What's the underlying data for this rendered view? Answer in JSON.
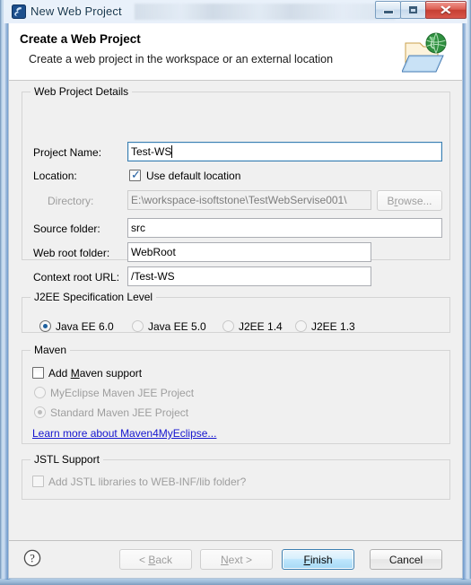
{
  "window": {
    "title": "New Web Project",
    "icon": "myeclipse-icon",
    "controls": {
      "minimize": "minimize-button",
      "maximize": "maximize-button",
      "close_glyph": "✕"
    }
  },
  "banner": {
    "title": "Create a Web Project",
    "description": "Create a web project in the workspace or an external location",
    "icon": "web-folder-globe-icon"
  },
  "groups": {
    "details": {
      "title": "Web Project Details",
      "project_name_label": "Project Name:",
      "project_name_value": "Test-WS",
      "project_name_placeholder": "",
      "location_label": "Location:",
      "use_default_location_label": "Use default location",
      "use_default_location_checked": true,
      "directory_label": "Directory:",
      "directory_value": "E:\\workspace-isoftstone\\TestWebServise001\\",
      "browse_label": "Browse...",
      "browse_mnemonic": "r",
      "source_folder_label": "Source folder:",
      "source_folder_value": "src",
      "web_root_label": "Web root folder:",
      "web_root_value": "WebRoot",
      "context_root_label": "Context root URL:",
      "context_root_value": "/Test-WS"
    },
    "j2ee": {
      "title": "J2EE Specification Level",
      "options": [
        {
          "label": "Java EE 6.0",
          "selected": true,
          "enabled": true
        },
        {
          "label": "Java EE 5.0",
          "selected": false,
          "enabled": true
        },
        {
          "label": "J2EE 1.4",
          "selected": false,
          "enabled": true
        },
        {
          "label": "J2EE 1.3",
          "selected": false,
          "enabled": true
        }
      ]
    },
    "maven": {
      "title": "Maven",
      "add_support_label_pre": "Add ",
      "add_support_mnemonic": "M",
      "add_support_label_post": "aven support",
      "add_support_checked": false,
      "options": [
        {
          "label": "MyEclipse Maven JEE Project",
          "selected": false,
          "enabled": false
        },
        {
          "label": "Standard Maven JEE Project",
          "selected": true,
          "enabled": false
        }
      ],
      "link_label": "Learn more about Maven4MyEclipse..."
    },
    "jstl": {
      "title": "JSTL Support",
      "add_jstl_label": "Add JSTL libraries to WEB-INF/lib folder?",
      "add_jstl_checked": false
    }
  },
  "buttonbar": {
    "help_icon": "help-question-icon",
    "back": {
      "label_pre": "< ",
      "mnemonic": "B",
      "label_post": "ack",
      "enabled": false
    },
    "next": {
      "label_pre": "",
      "mnemonic": "N",
      "label_post": "ext >",
      "enabled": false
    },
    "finish": {
      "mnemonic": "F",
      "label_post": "inish",
      "enabled": true,
      "is_default": true
    },
    "cancel": {
      "label": "Cancel",
      "enabled": true
    }
  },
  "colors": {
    "accent_blue": "#3c7fb1",
    "link_blue": "#1616cf",
    "titlebar_text": "#17374f",
    "close_red": "#c63f33",
    "dialog_bg": "#f0f0f0",
    "field_bg": "#ffffff",
    "disabled_text": "#9e9e9e"
  }
}
